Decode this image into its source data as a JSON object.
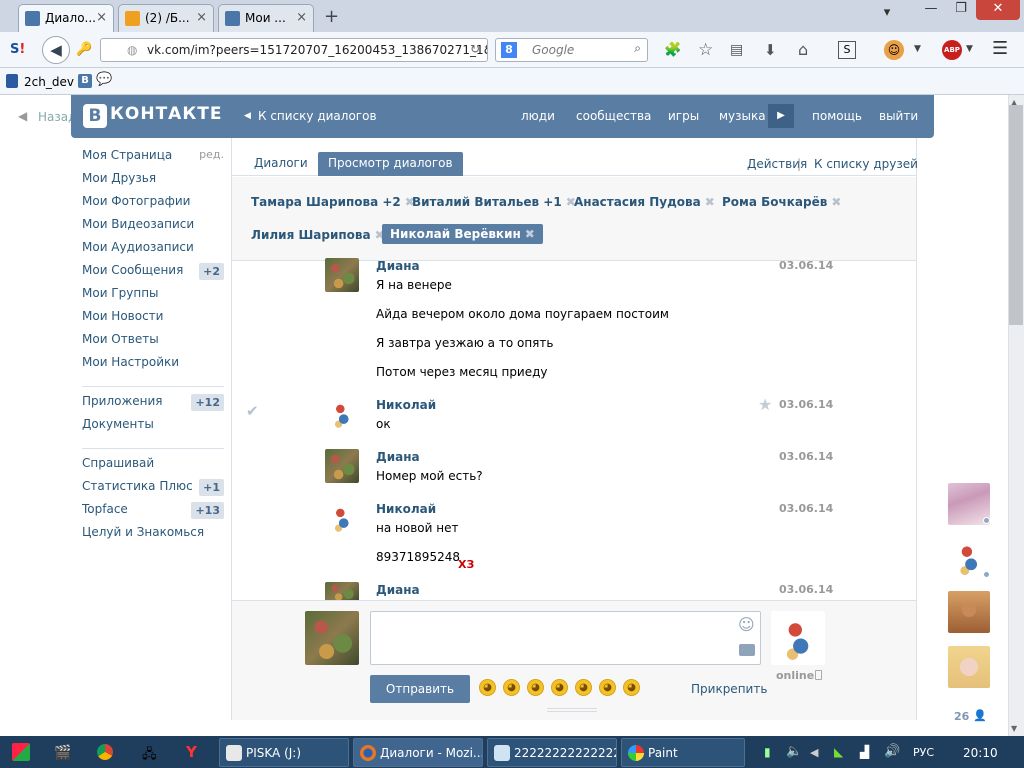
{
  "browser": {
    "tabs": [
      {
        "label": "Диало...",
        "close": "×"
      },
      {
        "label": "(2) /Б...",
        "close": "×"
      },
      {
        "label": "Мои ...",
        "close": "×"
      }
    ],
    "new_tab": "+",
    "window_controls": [
      "▾",
      "—",
      "❐",
      "✕"
    ],
    "url": "vk.com/im?peers=151720707_16200453_138670271_1&",
    "search_engine_placeholder": "Google",
    "bookmarks": [
      {
        "label": "2ch_dev"
      },
      {
        "label": "B"
      }
    ],
    "adblock_label": "ABP"
  },
  "vk": {
    "back_label": "Назад",
    "logo_letter": "В",
    "logo_text": "КОНТАКТЕ",
    "to_dialogs": "К списку диалогов",
    "nav": [
      "люди",
      "сообщества",
      "игры",
      "музыка",
      "помощь",
      "выйти"
    ],
    "left_menu_1": [
      {
        "label": "Моя Страница",
        "badge": "ред."
      },
      {
        "label": "Мои Друзья",
        "badge": ""
      },
      {
        "label": "Мои Фотографии",
        "badge": ""
      },
      {
        "label": "Мои Видеозаписи",
        "badge": ""
      },
      {
        "label": "Мои Аудиозаписи",
        "badge": ""
      },
      {
        "label": "Мои Сообщения",
        "badge": "+2"
      },
      {
        "label": "Мои Группы",
        "badge": ""
      },
      {
        "label": "Мои Новости",
        "badge": ""
      },
      {
        "label": "Мои Ответы",
        "badge": ""
      },
      {
        "label": "Мои Настройки",
        "badge": ""
      }
    ],
    "left_menu_2": [
      {
        "label": "Приложения",
        "badge": "+12"
      },
      {
        "label": "Документы",
        "badge": ""
      }
    ],
    "left_menu_3": [
      {
        "label": "Спрашивай",
        "badge": ""
      },
      {
        "label": "Статистика Плюс",
        "badge": "+1"
      },
      {
        "label": "Topface",
        "badge": "+13"
      },
      {
        "label": "Целуй и Знакомься",
        "badge": ""
      }
    ],
    "page_tabs": [
      "Диалоги",
      "Просмотр диалогов"
    ],
    "actions": "Действия",
    "actions_sep": "|",
    "to_friends": "К списку друзей",
    "peers_row1": [
      "Тамара Шарипова +2",
      "Виталий Витальев +1",
      "Анастасия Пудова",
      "Рома Бочкарёв"
    ],
    "peers_row2": [
      "Лилия Шарипова",
      "Николай Верёвкин"
    ],
    "peer_remove": "✖",
    "messages": [
      {
        "author": "Диана",
        "date": "03.06.14",
        "lines": [
          "Я на венере",
          "Айда вечером около дома поугараем постоим",
          "Я завтра уезжаю а то опять",
          "Потом через месяц приеду"
        ]
      },
      {
        "author": "Николай",
        "date": "03.06.14",
        "lines": [
          "ок"
        ]
      },
      {
        "author": "Диана",
        "date": "03.06.14",
        "lines": [
          "Номер мой есть?"
        ]
      },
      {
        "author": "Николай",
        "date": "03.06.14",
        "lines": [
          "на новой нет",
          "89371895248"
        ],
        "extra": "ХЗ"
      },
      {
        "author": "Диана",
        "date": "03.06.14",
        "lines": []
      }
    ],
    "send_label": "Отправить",
    "attach_label": "Прикрепить",
    "online_label": "online",
    "online_count": "26",
    "colors": {
      "header_blue": "#597da3",
      "link": "#2b587a",
      "badge_bg": "#dae1e8",
      "red_text": "#cc0000"
    }
  },
  "taskbar": {
    "items": [
      {
        "label": "PISKA (J:)"
      },
      {
        "label": "Диалоги - Mozi..."
      },
      {
        "label": "22222222222222..."
      },
      {
        "label": "Paint"
      }
    ],
    "lang": "РУС",
    "clock": "20:10"
  }
}
